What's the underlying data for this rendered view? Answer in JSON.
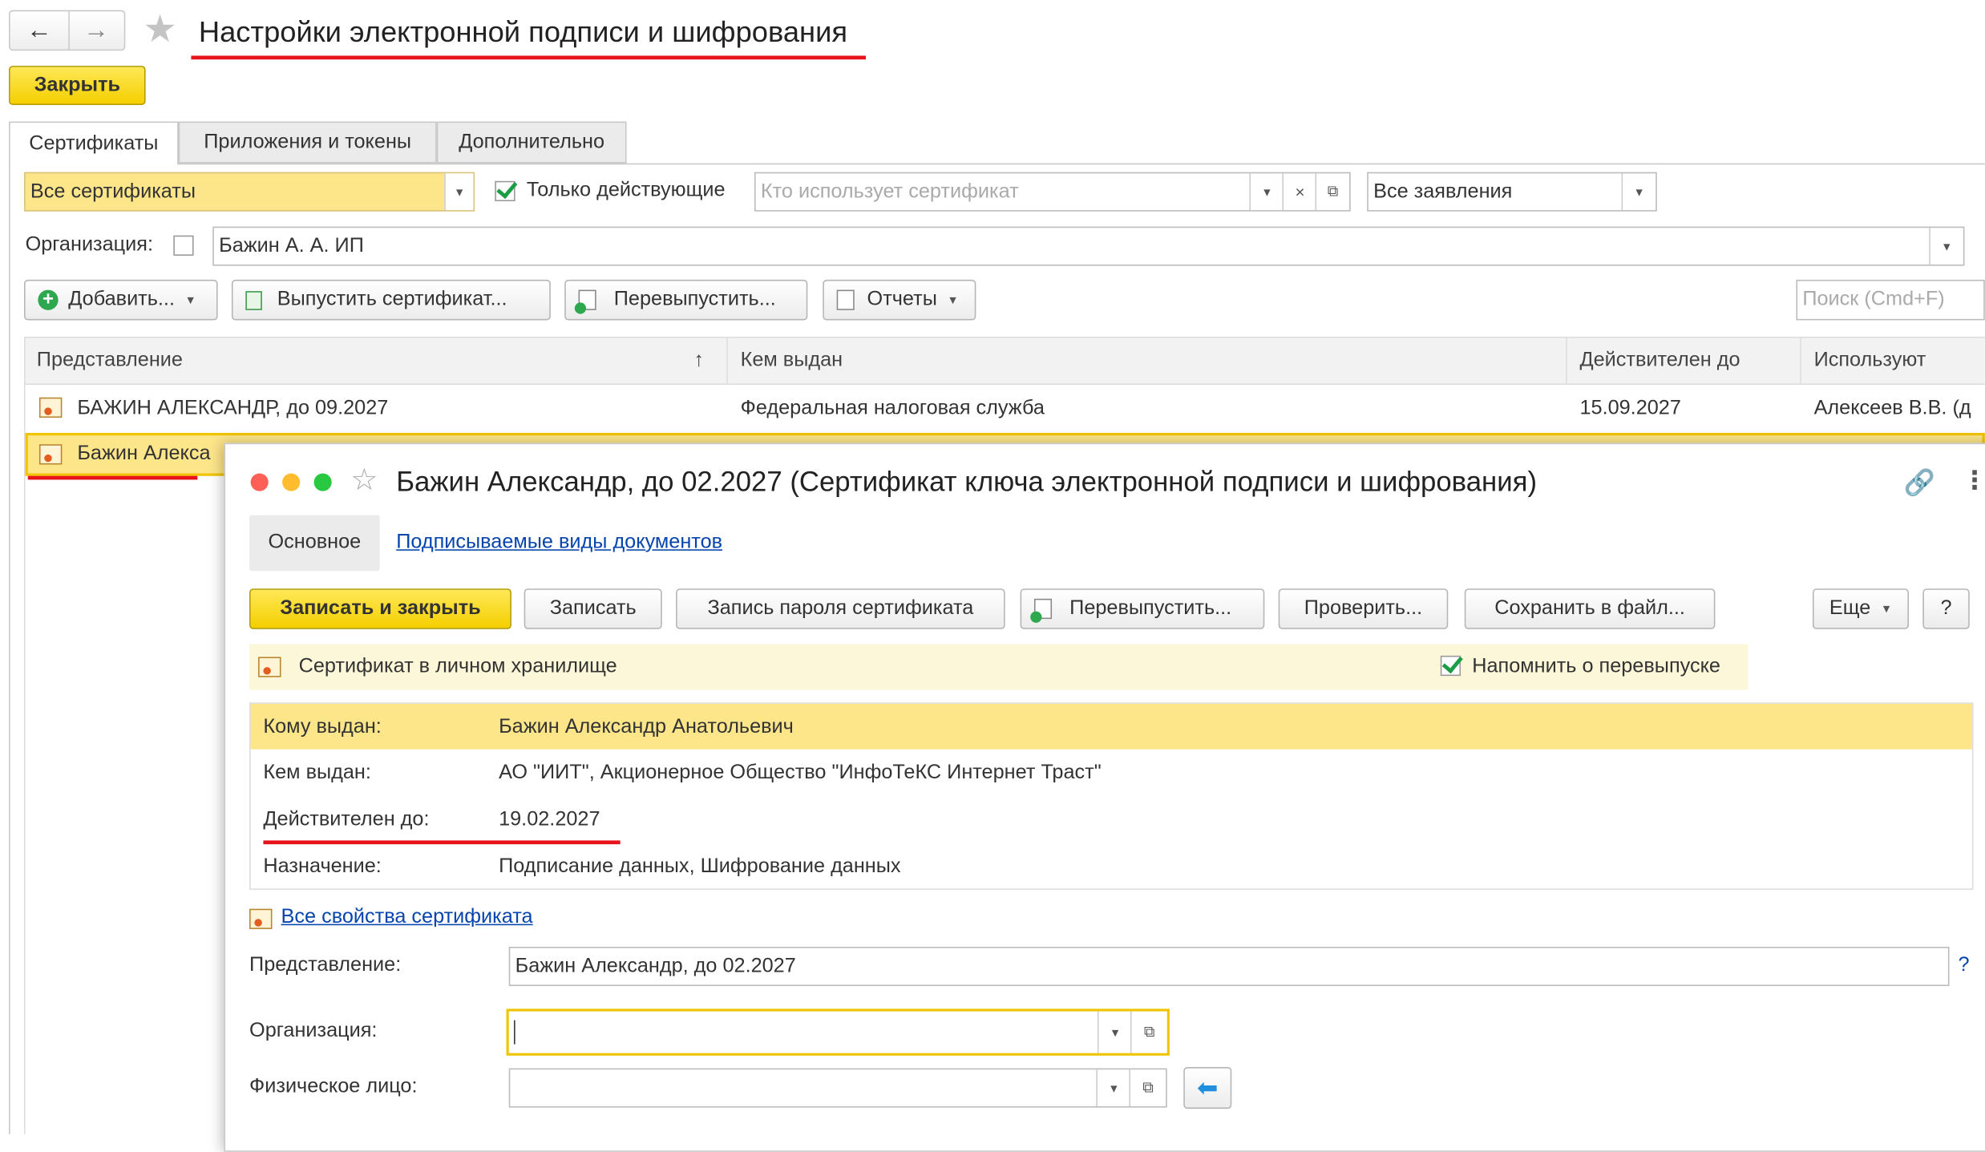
{
  "window": {
    "title": "Настройки электронной подписи и шифрования",
    "close_button": "Закрыть",
    "tabs": [
      "Сертификаты",
      "Приложения и токены",
      "Дополнительно"
    ]
  },
  "filters": {
    "certificate_kind": "Все сертификаты",
    "only_active_label": "Только действующие",
    "only_active_checked": true,
    "who_uses_placeholder": "Кто использует сертификат",
    "applications": "Все заявления",
    "organization_label": "Организация:",
    "organization_value": "Бажин А. А. ИП"
  },
  "toolbar": {
    "add": "Добавить...",
    "issue": "Выпустить сертификат...",
    "reissue": "Перевыпустить...",
    "reports": "Отчеты",
    "search_placeholder": "Поиск (Cmd+F)"
  },
  "table": {
    "columns": [
      "Представление",
      "Кем выдан",
      "Действителен до",
      "Используют"
    ],
    "sort_indicator": "↑",
    "rows": [
      {
        "name": "БАЖИН АЛЕКСАНДР, до 09.2027",
        "issuer": "Федеральная налоговая служба",
        "valid_to": "15.09.2027",
        "used_by": "Алексеев В.В. (д"
      },
      {
        "name": "Бажин Алекса"
      }
    ]
  },
  "dialog": {
    "title": "Бажин Александр, до 02.2027 (Сертификат ключа электронной подписи и шифрования)",
    "tab_main": "Основное",
    "tab_link": "Подписываемые виды документов",
    "buttons": {
      "save_close": "Записать и закрыть",
      "save": "Записать",
      "password": "Запись пароля сертификата",
      "reissue": "Перевыпустить...",
      "check": "Проверить...",
      "save_file": "Сохранить в файл...",
      "more": "Еще",
      "help": "?"
    },
    "storage_text": "Сертификат в личном хранилище",
    "remind_label": "Напомнить о перевыпуске",
    "remind_checked": true,
    "info": {
      "issued_to_label": "Кому выдан:",
      "issued_to": "Бажин Александр Анатольевич",
      "issued_by_label": "Кем выдан:",
      "issued_by": "АО \"ИИТ\", Акционерное Общество \"ИнфоТеКС Интернет Траст\"",
      "valid_label": "Действителен до:",
      "valid": "19.02.2027",
      "purpose_label": "Назначение:",
      "purpose": "Подписание данных, Шифрование данных"
    },
    "all_properties": "Все свойства сертификата",
    "presentation_label": "Представление:",
    "presentation_value": "Бажин Александр, до 02.2027",
    "organization_label": "Организация:",
    "person_label": "Физическое лицо:",
    "question_mark": "?"
  },
  "colors": {
    "accent_yellow": "#f4cf00",
    "highlight": "#fde58a",
    "underline_red": "#e8141c",
    "link": "#0645ad"
  }
}
